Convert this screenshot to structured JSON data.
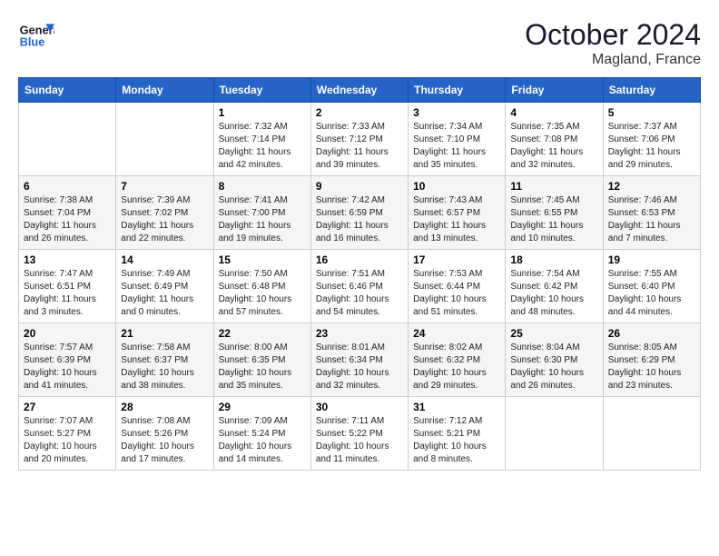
{
  "header": {
    "logo": {
      "line1": "General",
      "line2": "Blue"
    },
    "title": "October 2024",
    "location": "Magland, France"
  },
  "weekdays": [
    "Sunday",
    "Monday",
    "Tuesday",
    "Wednesday",
    "Thursday",
    "Friday",
    "Saturday"
  ],
  "weeks": [
    [
      {
        "day": "",
        "info": ""
      },
      {
        "day": "",
        "info": ""
      },
      {
        "day": "1",
        "info": "Sunrise: 7:32 AM\nSunset: 7:14 PM\nDaylight: 11 hours and 42 minutes."
      },
      {
        "day": "2",
        "info": "Sunrise: 7:33 AM\nSunset: 7:12 PM\nDaylight: 11 hours and 39 minutes."
      },
      {
        "day": "3",
        "info": "Sunrise: 7:34 AM\nSunset: 7:10 PM\nDaylight: 11 hours and 35 minutes."
      },
      {
        "day": "4",
        "info": "Sunrise: 7:35 AM\nSunset: 7:08 PM\nDaylight: 11 hours and 32 minutes."
      },
      {
        "day": "5",
        "info": "Sunrise: 7:37 AM\nSunset: 7:06 PM\nDaylight: 11 hours and 29 minutes."
      }
    ],
    [
      {
        "day": "6",
        "info": "Sunrise: 7:38 AM\nSunset: 7:04 PM\nDaylight: 11 hours and 26 minutes."
      },
      {
        "day": "7",
        "info": "Sunrise: 7:39 AM\nSunset: 7:02 PM\nDaylight: 11 hours and 22 minutes."
      },
      {
        "day": "8",
        "info": "Sunrise: 7:41 AM\nSunset: 7:00 PM\nDaylight: 11 hours and 19 minutes."
      },
      {
        "day": "9",
        "info": "Sunrise: 7:42 AM\nSunset: 6:59 PM\nDaylight: 11 hours and 16 minutes."
      },
      {
        "day": "10",
        "info": "Sunrise: 7:43 AM\nSunset: 6:57 PM\nDaylight: 11 hours and 13 minutes."
      },
      {
        "day": "11",
        "info": "Sunrise: 7:45 AM\nSunset: 6:55 PM\nDaylight: 11 hours and 10 minutes."
      },
      {
        "day": "12",
        "info": "Sunrise: 7:46 AM\nSunset: 6:53 PM\nDaylight: 11 hours and 7 minutes."
      }
    ],
    [
      {
        "day": "13",
        "info": "Sunrise: 7:47 AM\nSunset: 6:51 PM\nDaylight: 11 hours and 3 minutes."
      },
      {
        "day": "14",
        "info": "Sunrise: 7:49 AM\nSunset: 6:49 PM\nDaylight: 11 hours and 0 minutes."
      },
      {
        "day": "15",
        "info": "Sunrise: 7:50 AM\nSunset: 6:48 PM\nDaylight: 10 hours and 57 minutes."
      },
      {
        "day": "16",
        "info": "Sunrise: 7:51 AM\nSunset: 6:46 PM\nDaylight: 10 hours and 54 minutes."
      },
      {
        "day": "17",
        "info": "Sunrise: 7:53 AM\nSunset: 6:44 PM\nDaylight: 10 hours and 51 minutes."
      },
      {
        "day": "18",
        "info": "Sunrise: 7:54 AM\nSunset: 6:42 PM\nDaylight: 10 hours and 48 minutes."
      },
      {
        "day": "19",
        "info": "Sunrise: 7:55 AM\nSunset: 6:40 PM\nDaylight: 10 hours and 44 minutes."
      }
    ],
    [
      {
        "day": "20",
        "info": "Sunrise: 7:57 AM\nSunset: 6:39 PM\nDaylight: 10 hours and 41 minutes."
      },
      {
        "day": "21",
        "info": "Sunrise: 7:58 AM\nSunset: 6:37 PM\nDaylight: 10 hours and 38 minutes."
      },
      {
        "day": "22",
        "info": "Sunrise: 8:00 AM\nSunset: 6:35 PM\nDaylight: 10 hours and 35 minutes."
      },
      {
        "day": "23",
        "info": "Sunrise: 8:01 AM\nSunset: 6:34 PM\nDaylight: 10 hours and 32 minutes."
      },
      {
        "day": "24",
        "info": "Sunrise: 8:02 AM\nSunset: 6:32 PM\nDaylight: 10 hours and 29 minutes."
      },
      {
        "day": "25",
        "info": "Sunrise: 8:04 AM\nSunset: 6:30 PM\nDaylight: 10 hours and 26 minutes."
      },
      {
        "day": "26",
        "info": "Sunrise: 8:05 AM\nSunset: 6:29 PM\nDaylight: 10 hours and 23 minutes."
      }
    ],
    [
      {
        "day": "27",
        "info": "Sunrise: 7:07 AM\nSunset: 5:27 PM\nDaylight: 10 hours and 20 minutes."
      },
      {
        "day": "28",
        "info": "Sunrise: 7:08 AM\nSunset: 5:26 PM\nDaylight: 10 hours and 17 minutes."
      },
      {
        "day": "29",
        "info": "Sunrise: 7:09 AM\nSunset: 5:24 PM\nDaylight: 10 hours and 14 minutes."
      },
      {
        "day": "30",
        "info": "Sunrise: 7:11 AM\nSunset: 5:22 PM\nDaylight: 10 hours and 11 minutes."
      },
      {
        "day": "31",
        "info": "Sunrise: 7:12 AM\nSunset: 5:21 PM\nDaylight: 10 hours and 8 minutes."
      },
      {
        "day": "",
        "info": ""
      },
      {
        "day": "",
        "info": ""
      }
    ]
  ]
}
